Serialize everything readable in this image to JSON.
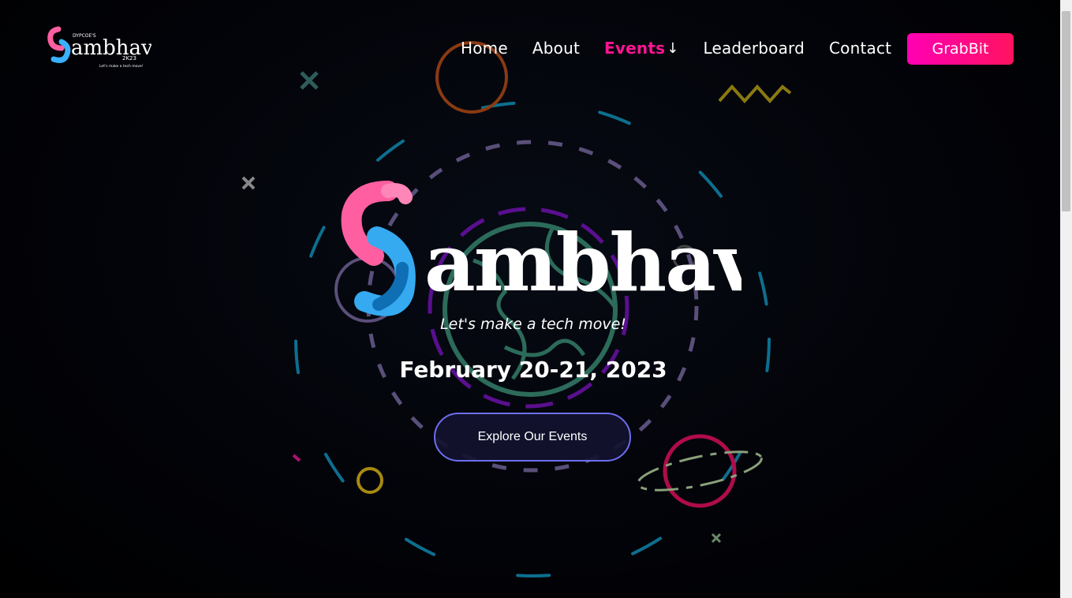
{
  "header": {
    "logo": {
      "brand_text": "ambhav",
      "small_top": "DYPCOE'S",
      "year": "2K23",
      "tagline": "Let's make a tech move!"
    },
    "nav": {
      "home": "Home",
      "about": "About",
      "events": "Events",
      "leaderboard": "Leaderboard",
      "contact": "Contact"
    },
    "cta": "GrabBit"
  },
  "hero": {
    "brand_text": "ambhav",
    "tagline": "Let's make a tech move!",
    "date": "February 20-21, 2023",
    "explore_button": "Explore Our Events"
  },
  "colors": {
    "accent_pink": "#ff1493",
    "grab_gradient_start": "#ff00b4",
    "grab_gradient_end": "#ff1360",
    "button_border": "#6e6ef0"
  },
  "icons": {
    "events_dropdown": "arrow-down-icon"
  }
}
